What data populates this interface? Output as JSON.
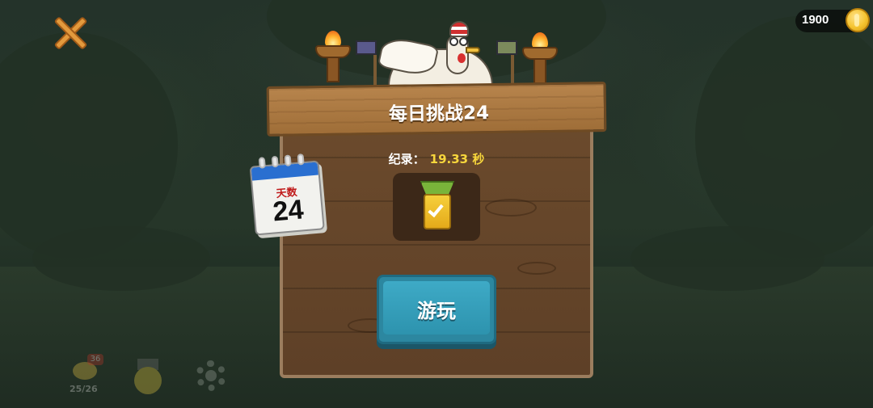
{
  "header": {
    "coins": "1900"
  },
  "challenge": {
    "title": "每日挑战24",
    "record_label": "纪录：",
    "record_value": "19.33 秒"
  },
  "calendar": {
    "label": "天数",
    "day": "24"
  },
  "actions": {
    "play_label": "游玩"
  },
  "bottom_bar": {
    "chicken_badge": "36",
    "chicken_count": "25/26"
  },
  "icons": {
    "close": "close-icon",
    "coin": "coin-icon",
    "medal": "medal-check-icon",
    "calendar": "calendar-icon",
    "chicken": "chicken-icon",
    "achievement": "medal-icon",
    "settings": "gear-icon"
  },
  "colors": {
    "board": "#5e4027",
    "title_plank": "#a9773f",
    "play_button": "#3eaac6",
    "record_value": "#f7d63c",
    "close_x": "#e39a3d",
    "calendar_header": "#2a6fd0",
    "calendar_label": "#c01a1a"
  }
}
